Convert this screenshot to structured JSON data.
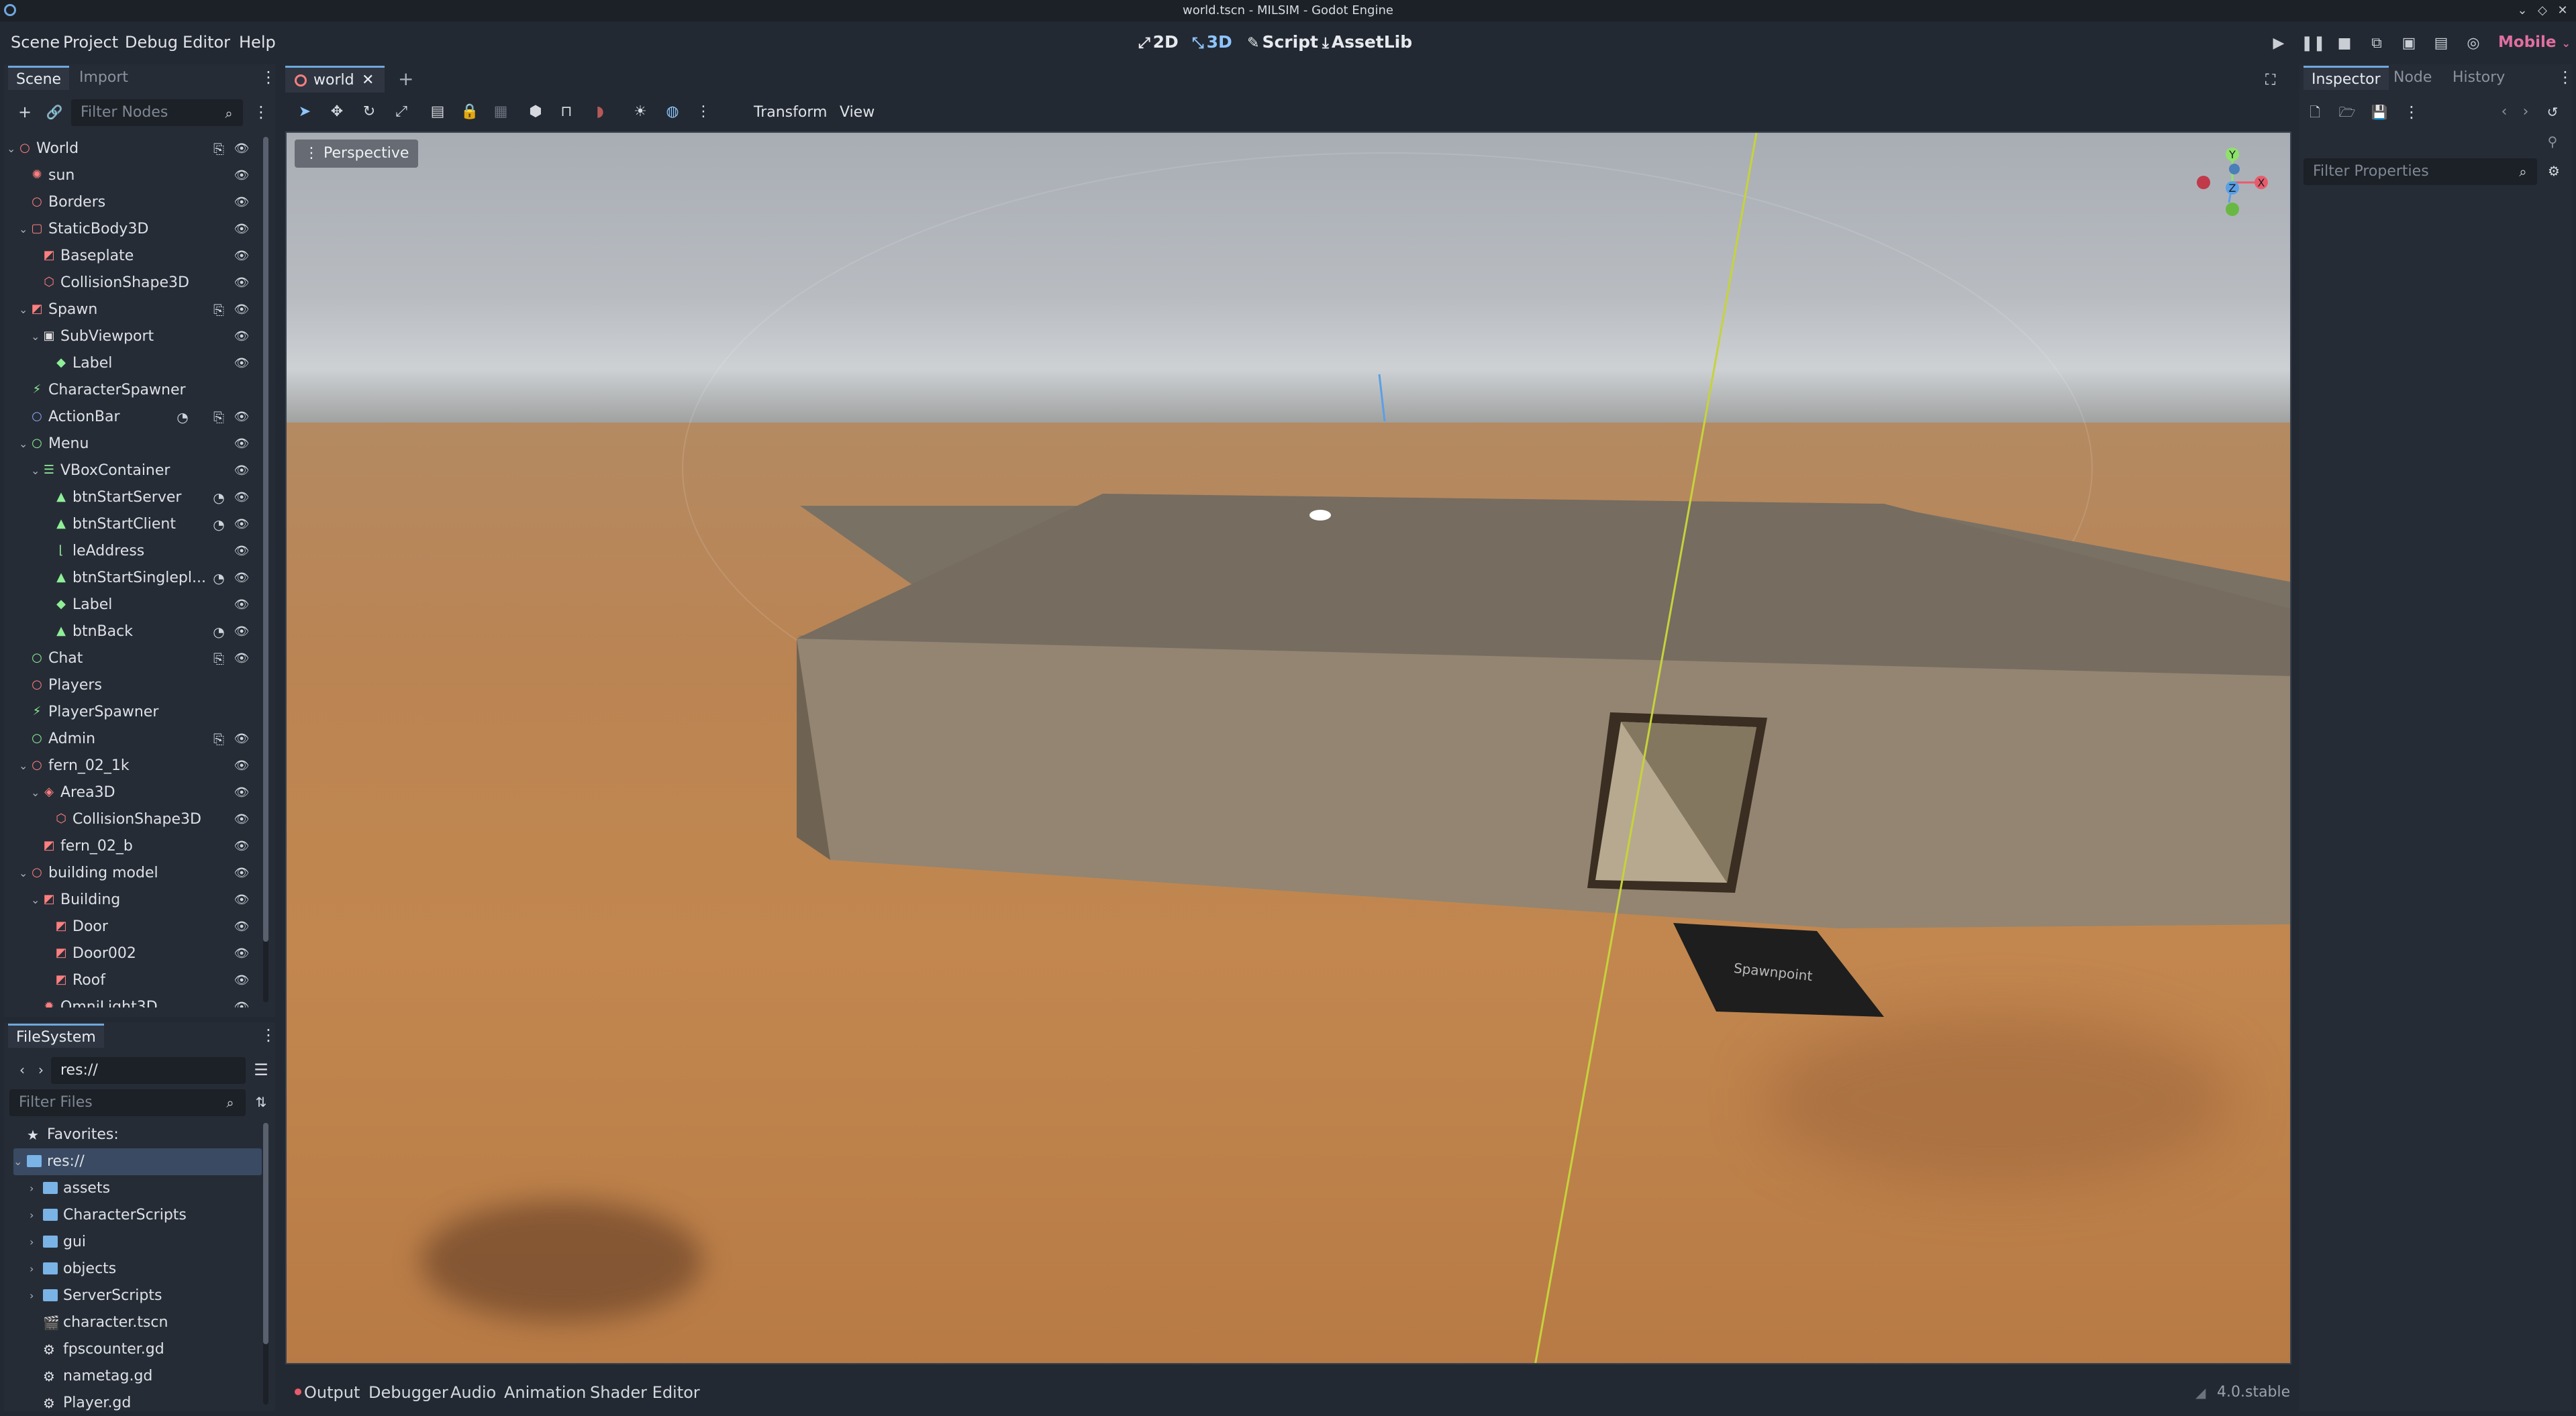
{
  "window": {
    "title": "world.tscn - MILSIM - Godot Engine"
  },
  "menu": [
    "Scene",
    "Project",
    "Debug",
    "Editor",
    "Help"
  ],
  "main_screens": [
    {
      "label": "2D",
      "icon": "2d-icon"
    },
    {
      "label": "3D",
      "icon": "3d-icon",
      "active": true
    },
    {
      "label": "Script",
      "icon": "script-icon"
    },
    {
      "label": "AssetLib",
      "icon": "assetlib-icon"
    }
  ],
  "renderer": "Mobile",
  "scene_dock": {
    "tabs": [
      "Scene",
      "Import"
    ],
    "filter_placeholder": "Filter Nodes",
    "nodes": [
      {
        "name": "World",
        "depth": 0,
        "icon": "node3d-icon",
        "color": "#fc7f7f"
      },
      {
        "name": "sun",
        "depth": 1,
        "icon": "directional-light-icon",
        "color": "#fc7f7f"
      },
      {
        "name": "Borders",
        "depth": 1,
        "icon": "node3d-icon",
        "color": "#fc7f7f"
      },
      {
        "name": "StaticBody3D",
        "depth": 1,
        "icon": "static-body-icon",
        "color": "#fc7f7f"
      },
      {
        "name": "Baseplate",
        "depth": 2,
        "icon": "mesh-instance-icon",
        "color": "#fc7f7f"
      },
      {
        "name": "CollisionShape3D",
        "depth": 2,
        "icon": "collision-shape-icon",
        "color": "#fc7f7f"
      },
      {
        "name": "Spawn",
        "depth": 1,
        "icon": "mesh-instance-icon",
        "color": "#fc7f7f"
      },
      {
        "name": "SubViewport",
        "depth": 2,
        "icon": "subviewport-icon",
        "color": "#e0e0e0"
      },
      {
        "name": "Label",
        "depth": 3,
        "icon": "label-icon",
        "color": "#8eef97"
      },
      {
        "name": "CharacterSpawner",
        "depth": 1,
        "icon": "spawner-icon",
        "color": "#8eef97"
      },
      {
        "name": "ActionBar",
        "depth": 1,
        "icon": "node-icon",
        "color": "#8da5f3"
      },
      {
        "name": "Menu",
        "depth": 1,
        "icon": "control-icon",
        "color": "#8eef97"
      },
      {
        "name": "VBoxContainer",
        "depth": 2,
        "icon": "vbox-icon",
        "color": "#8eef97"
      },
      {
        "name": "btnStartServer",
        "depth": 3,
        "icon": "button-icon",
        "color": "#8eef97"
      },
      {
        "name": "btnStartClient",
        "depth": 3,
        "icon": "button-icon",
        "color": "#8eef97"
      },
      {
        "name": "leAddress",
        "depth": 3,
        "icon": "line-edit-icon",
        "color": "#8eef97"
      },
      {
        "name": "btnStartSinglepl...",
        "depth": 3,
        "icon": "button-icon",
        "color": "#8eef97"
      },
      {
        "name": "Label",
        "depth": 3,
        "icon": "label-icon",
        "color": "#8eef97"
      },
      {
        "name": "btnBack",
        "depth": 3,
        "icon": "button-icon",
        "color": "#8eef97"
      },
      {
        "name": "Chat",
        "depth": 1,
        "icon": "control-icon",
        "color": "#8eef97"
      },
      {
        "name": "Players",
        "depth": 1,
        "icon": "node3d-icon",
        "color": "#fc7f7f"
      },
      {
        "name": "PlayerSpawner",
        "depth": 1,
        "icon": "spawner-icon",
        "color": "#8eef97"
      },
      {
        "name": "Admin",
        "depth": 1,
        "icon": "control-icon",
        "color": "#8eef97"
      },
      {
        "name": "fern_02_1k",
        "depth": 1,
        "icon": "node3d-icon",
        "color": "#fc7f7f"
      },
      {
        "name": "Area3D",
        "depth": 2,
        "icon": "area3d-icon",
        "color": "#fc7f7f"
      },
      {
        "name": "CollisionShape3D",
        "depth": 3,
        "icon": "collision-shape-icon",
        "color": "#fc7f7f"
      },
      {
        "name": "fern_02_b",
        "depth": 2,
        "icon": "mesh-instance-icon",
        "color": "#fc7f7f"
      },
      {
        "name": "building model",
        "depth": 1,
        "icon": "node3d-icon",
        "color": "#fc7f7f"
      },
      {
        "name": "Building",
        "depth": 2,
        "icon": "mesh-instance-icon",
        "color": "#fc7f7f"
      },
      {
        "name": "Door",
        "depth": 3,
        "icon": "mesh-instance-icon",
        "color": "#fc7f7f"
      },
      {
        "name": "Door002",
        "depth": 3,
        "icon": "mesh-instance-icon",
        "color": "#fc7f7f"
      },
      {
        "name": "Roof",
        "depth": 3,
        "icon": "mesh-instance-icon",
        "color": "#fc7f7f"
      },
      {
        "name": "OmniLight3D",
        "depth": 2,
        "icon": "omni-light-icon",
        "color": "#fc7f7f"
      }
    ]
  },
  "filesystem": {
    "title": "FileSystem",
    "path": "res://",
    "filter_placeholder": "Filter Files",
    "items": [
      {
        "label": "Favorites:",
        "type": "favorites",
        "depth": 0
      },
      {
        "label": "res://",
        "type": "folder",
        "depth": 0,
        "selected": true
      },
      {
        "label": "assets",
        "type": "folder",
        "depth": 1
      },
      {
        "label": "CharacterScripts",
        "type": "folder",
        "depth": 1
      },
      {
        "label": "gui",
        "type": "folder",
        "depth": 1
      },
      {
        "label": "objects",
        "type": "folder",
        "depth": 1
      },
      {
        "label": "ServerScripts",
        "type": "folder",
        "depth": 1
      },
      {
        "label": "character.tscn",
        "type": "scene",
        "depth": 1
      },
      {
        "label": "fpscounter.gd",
        "type": "script",
        "depth": 1
      },
      {
        "label": "nametag.gd",
        "type": "script",
        "depth": 1
      },
      {
        "label": "Player.gd",
        "type": "script",
        "depth": 1
      }
    ]
  },
  "editor_tabs": [
    {
      "label": "world",
      "active": true
    }
  ],
  "viewport": {
    "toolbar": [
      "Transform",
      "View"
    ],
    "perspective_label": "Perspective",
    "gizmo_axes": [
      "Y",
      "X",
      "Z"
    ],
    "spawnpoint_label": "Spawnpoint"
  },
  "bottom_panel": {
    "tabs": [
      "Output",
      "Debugger",
      "Audio",
      "Animation",
      "Shader Editor"
    ],
    "version": "4.0.stable"
  },
  "inspector": {
    "tabs": [
      "Inspector",
      "Node",
      "History"
    ],
    "filter_placeholder": "Filter Properties"
  },
  "colors": {
    "accent": "#6fa8dc",
    "node3d": "#fc7f7f",
    "control": "#8eef97",
    "renderer": "#e06fa0"
  }
}
